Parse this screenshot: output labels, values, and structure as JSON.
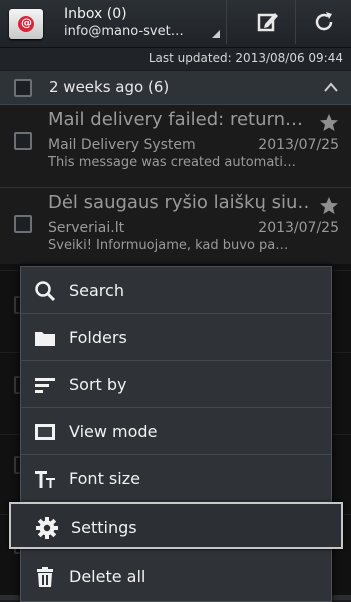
{
  "header": {
    "account_title": "Inbox (0)",
    "account_email": "info@mano-svet…",
    "compose_icon": "compose-icon",
    "refresh_icon": "refresh-icon"
  },
  "status": {
    "last_updated": "Last updated: 2013/08/06 09:44"
  },
  "group": {
    "label": "2 weeks ago (6)"
  },
  "messages": [
    {
      "subject": "Mail delivery failed: return…",
      "sender": "Mail Delivery System",
      "date": "2013/07/25",
      "preview": "This message was created automati…"
    },
    {
      "subject": "Dėl saugaus ryšio laiškų siu…",
      "sender": "Serveriai.lt",
      "date": "2013/07/25",
      "preview": "Sveiki! Informuojame, kad buvo pa…"
    }
  ],
  "menu": {
    "items": [
      {
        "label": "Search",
        "icon": "search-icon"
      },
      {
        "label": "Folders",
        "icon": "folder-icon"
      },
      {
        "label": "Sort by",
        "icon": "sort-icon"
      },
      {
        "label": "View mode",
        "icon": "view-mode-icon"
      },
      {
        "label": "Font size",
        "icon": "font-size-icon"
      },
      {
        "label": "Settings",
        "icon": "gear-icon"
      },
      {
        "label": "Delete all",
        "icon": "trash-icon"
      }
    ]
  },
  "colors": {
    "menu_bg": "#2f3236",
    "header_bg": "#2b3035",
    "text_dim": "#9a9a9a"
  }
}
